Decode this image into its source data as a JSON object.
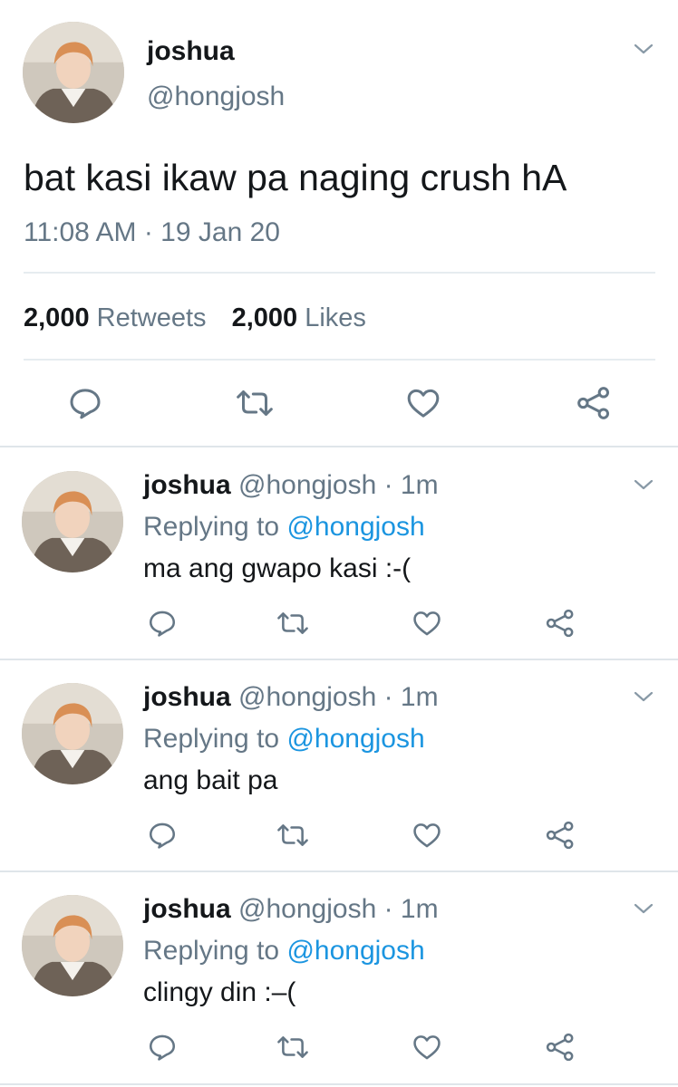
{
  "main_tweet": {
    "name": "joshua",
    "handle": "@hongjosh",
    "text": "bat kasi ikaw pa naging crush hA",
    "timestamp": "11:08 AM · 19 Jan 20",
    "retweets_count": "2,000",
    "retweets_label": "Retweets",
    "likes_count": "2,000",
    "likes_label": "Likes"
  },
  "replies": [
    {
      "name": "joshua",
      "handle": "@hongjosh",
      "time": "· 1m",
      "replying_prefix": "Replying to",
      "replying_handle": "@hongjosh",
      "text": "ma ang gwapo kasi :-("
    },
    {
      "name": "joshua",
      "handle": "@hongjosh",
      "time": "· 1m",
      "replying_prefix": "Replying to",
      "replying_handle": "@hongjosh",
      "text": "ang bait pa"
    },
    {
      "name": "joshua",
      "handle": "@hongjosh",
      "time": "· 1m",
      "replying_prefix": "Replying to",
      "replying_handle": "@hongjosh",
      "text": "clingy din :–("
    }
  ],
  "icons": [
    "chevron-down-icon",
    "reply-icon",
    "retweet-icon",
    "like-icon",
    "share-icon"
  ],
  "colors": {
    "text": "#14171a",
    "muted": "#657786",
    "link": "#1b95e0",
    "divider": "#e6ecf0"
  }
}
